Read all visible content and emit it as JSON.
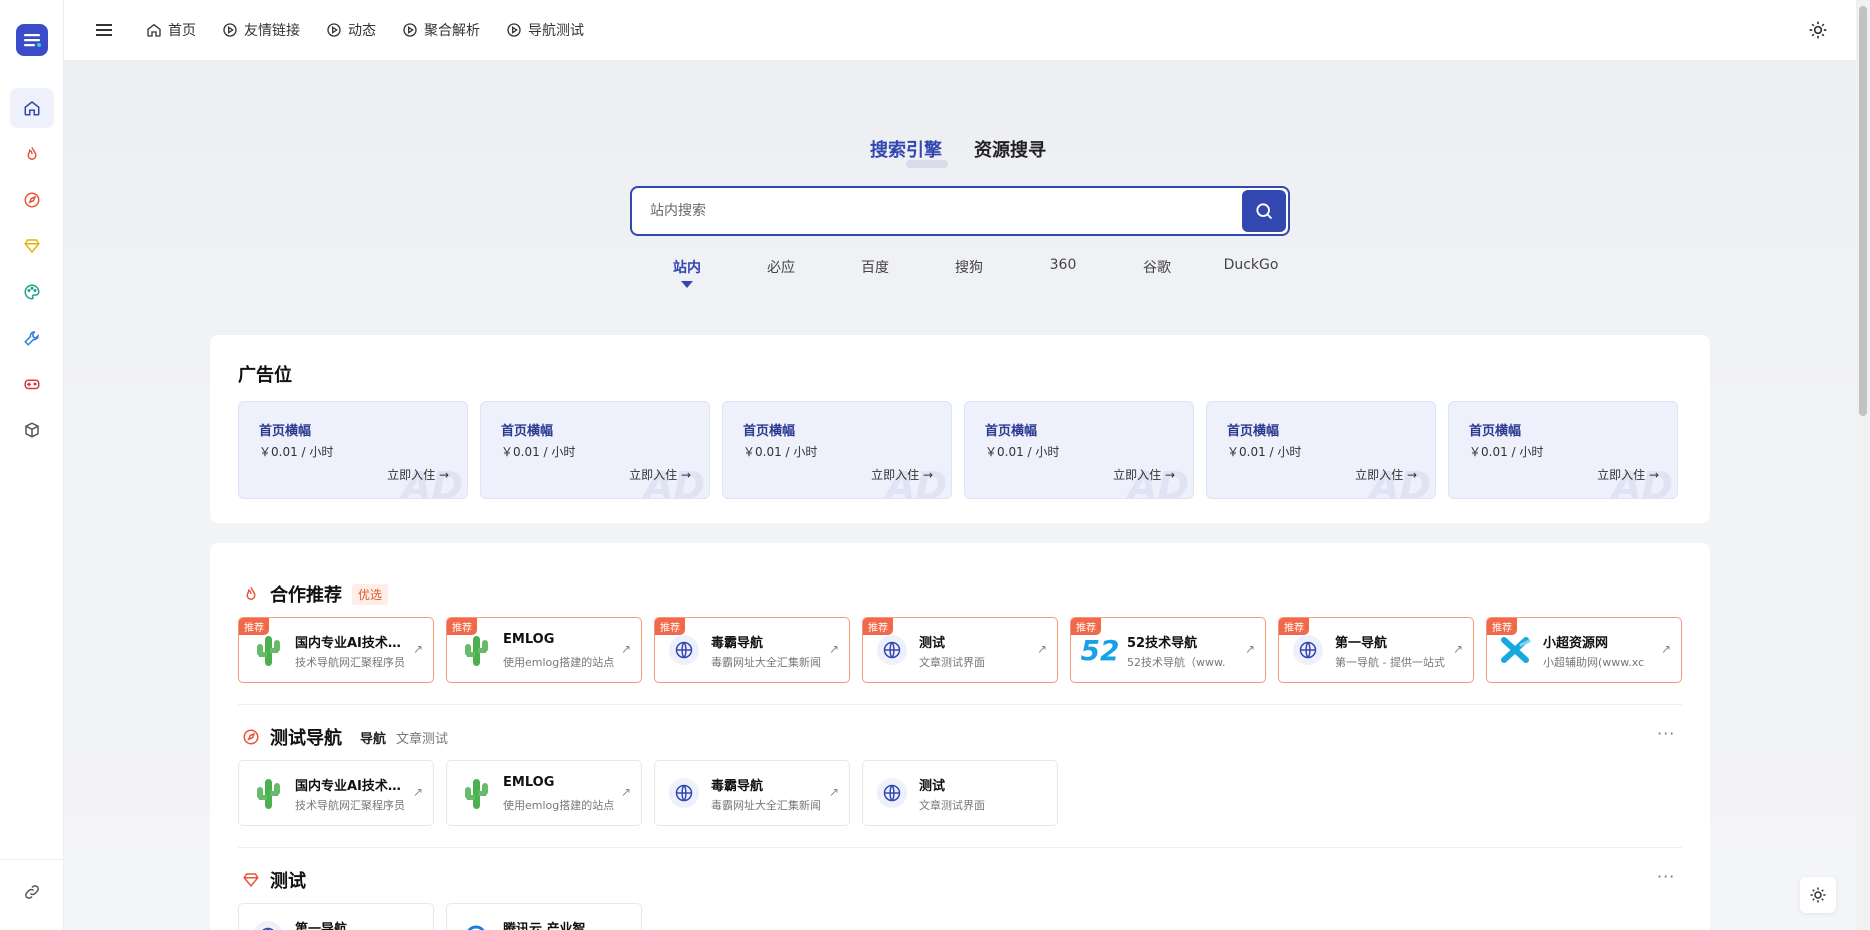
{
  "nav": {
    "items": [
      {
        "label": "首页",
        "icon": "home-icon"
      },
      {
        "label": "友情链接",
        "icon": "play-circle-icon"
      },
      {
        "label": "动态",
        "icon": "play-circle-icon"
      },
      {
        "label": "聚合解析",
        "icon": "play-circle-icon"
      },
      {
        "label": "导航测试",
        "icon": "play-circle-icon"
      }
    ]
  },
  "sidebar": {
    "icons": [
      "home-icon",
      "fire-icon",
      "compass-icon",
      "diamond-icon",
      "palette-icon",
      "wrench-icon",
      "gamepad-icon",
      "box-icon"
    ],
    "bottom_icon": "link-icon"
  },
  "search": {
    "tabs": [
      "搜索引擎",
      "资源搜寻"
    ],
    "placeholder": "站内搜索",
    "engines": [
      "站内",
      "必应",
      "百度",
      "搜狗",
      "360",
      "谷歌",
      "DuckGo"
    ]
  },
  "ads": {
    "title": "广告位",
    "cards": [
      {
        "name": "首页横幅",
        "price": "￥0.01 / 小时",
        "cta": "立即入住 →",
        "watermark": "AD"
      },
      {
        "name": "首页横幅",
        "price": "￥0.01 / 小时",
        "cta": "立即入住 →",
        "watermark": "AD"
      },
      {
        "name": "首页横幅",
        "price": "￥0.01 / 小时",
        "cta": "立即入住 →",
        "watermark": "AD"
      },
      {
        "name": "首页横幅",
        "price": "￥0.01 / 小时",
        "cta": "立即入住 →",
        "watermark": "AD"
      },
      {
        "name": "首页横幅",
        "price": "￥0.01 / 小时",
        "cta": "立即入住 →",
        "watermark": "AD"
      },
      {
        "name": "首页横幅",
        "price": "￥0.01 / 小时",
        "cta": "立即入住 →",
        "watermark": "AD"
      }
    ]
  },
  "sections": {
    "coop": {
      "title": "合作推荐",
      "tag": "优选",
      "badge": "推荐",
      "sites": [
        {
          "name": "国内专业AI技术导航",
          "desc": "技术导航网汇聚程序员",
          "icon": "cactus-icon"
        },
        {
          "name": "EMLOG",
          "desc": "使用emlog搭建的站点",
          "icon": "cactus-icon"
        },
        {
          "name": "毒霸导航",
          "desc": "毒霸网址大全汇集新闻",
          "icon": "globe-icon"
        },
        {
          "name": "测试",
          "desc": "文章测试界面",
          "icon": "globe-icon"
        },
        {
          "name": "52技术导航",
          "desc": "52技术导航（www.",
          "icon": "52-logo-icon"
        },
        {
          "name": "第一导航",
          "desc": "第一导航 - 提供一站式",
          "icon": "globe-icon"
        },
        {
          "name": "小超资源网",
          "desc": "小超辅助网(www.xc",
          "icon": "x-logo-icon"
        }
      ]
    },
    "testnav": {
      "title": "测试导航",
      "tabs": [
        "导航",
        "文章测试"
      ],
      "more": "···",
      "sites": [
        {
          "name": "国内专业AI技术导航",
          "desc": "技术导航网汇聚程序员",
          "icon": "cactus-icon"
        },
        {
          "name": "EMLOG",
          "desc": "使用emlog搭建的站点",
          "icon": "cactus-icon"
        },
        {
          "name": "毒霸导航",
          "desc": "毒霸网址大全汇集新闻",
          "icon": "globe-icon"
        },
        {
          "name": "测试",
          "desc": "文章测试界面",
          "icon": "globe-icon"
        }
      ]
    },
    "test": {
      "title": "测试",
      "more": "···",
      "sites": [
        {
          "name": "第一导航",
          "icon": "globe-icon"
        },
        {
          "name": "腾讯云 产业智",
          "icon": "tencent-cloud-icon"
        }
      ]
    }
  },
  "colors": {
    "accent": "#3347b0",
    "recommend": "#f06a4a",
    "ad_bg": "#eef0fb"
  }
}
